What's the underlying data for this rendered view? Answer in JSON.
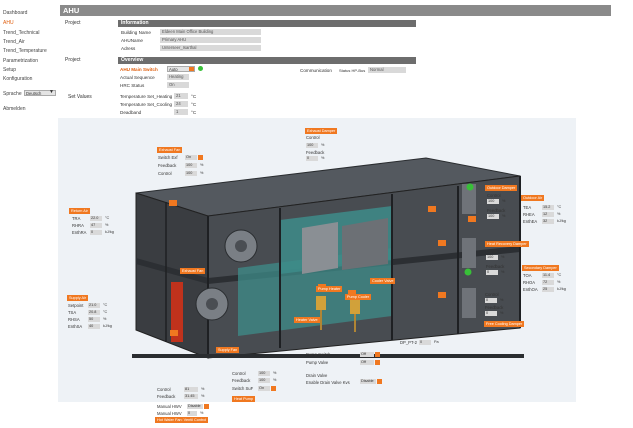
{
  "nav": {
    "items": [
      "Dashboard",
      "AHU",
      "Trend_Technical",
      "Trend_Air",
      "Trend_Temperature",
      "Parametrization",
      "Setup",
      "Konfiguration"
    ],
    "language_label": "Sprache",
    "language_value": "Deutsch",
    "logout": "Abmelden"
  },
  "page": {
    "title": "AHU"
  },
  "project": {
    "label": "Project",
    "information": {
      "header": "Information",
      "rows": [
        {
          "label": "Building Name",
          "value": "Eldeen Main Office Building"
        },
        {
          "label": "AHUName",
          "value": "Primary AHU"
        },
        {
          "label": "Adress",
          "value": "Unterseer_Isarthal"
        }
      ]
    }
  },
  "overview": {
    "header": "Overview",
    "label": "Project",
    "main_switch_label": "AHU Main Switch",
    "main_switch_value": "Auto",
    "actual_sequence_label": "Actual Sequence",
    "actual_sequence_value": "Heating",
    "hrc_status_label": "HRC Status",
    "hrc_status_value": "On",
    "communication_label": "Communication",
    "status_label": "Status HP-Bus",
    "status_value": "Normal"
  },
  "setvalues": {
    "label": "Set Values",
    "rows": [
      {
        "label": "Temperature Set_Heating",
        "value": "21",
        "unit": "°C"
      },
      {
        "label": "Temperature Set_Cooling",
        "value": "24",
        "unit": "°C"
      },
      {
        "label": "Deadband",
        "value": "1",
        "unit": "°C"
      }
    ]
  },
  "tags": {
    "exhaust_damper": "Exhaust Damper",
    "exhaust_fan": "Exhaust Fan",
    "return_air": "Return Air",
    "exhaust_air_fan": "Exhaust Fan",
    "outdoor_air": "Outdoor Air",
    "supply_air": "Supply Air",
    "outdoor_damper": "Outdoor Damper",
    "secondary_damper": "Secondary Damper",
    "heat_recovery": "Heat Recovery Damper",
    "free_cooling": "Free Cooling Damper",
    "supply_fan": "Supply Fan",
    "pump_heater": "Pump Heater",
    "pump_cooler": "Pump Cooler",
    "heater_valve": "Heater Valve",
    "cooler_valve": "Cooler Valve",
    "heat_pump": "Heat Pump",
    "hot_water_fan": "Hot Water Fan: Ventil Control"
  },
  "panels": {
    "exhaust_fan": {
      "switch_label": "Switch Exf",
      "switch_value": "On",
      "feedback_label": "Feedback",
      "feedback_value": "100",
      "control_label": "Control",
      "control_value": "100",
      "unit": "%"
    },
    "exhaust_damper": {
      "control_label": "Control",
      "control_value": "100",
      "feedback_label": "Feedback",
      "feedback_value": "0",
      "unit": "%"
    },
    "return_air": {
      "tra_label": "TRA",
      "tra_value": "22.0",
      "tra_unit": "°C",
      "rhra_label": "RHRA",
      "rhra_value": "47",
      "rhra_unit": "%",
      "enthra_label": "EnthRA",
      "enthra_value": "0",
      "enthra_unit": "kJ/kg"
    },
    "supply_air": {
      "rows": [
        {
          "label": "Setpoint",
          "value": "21.0",
          "unit": "°C"
        },
        {
          "label": "TSA",
          "value": "20.8",
          "unit": "°C"
        },
        {
          "label": "RHSA",
          "value": "50",
          "unit": "%"
        },
        {
          "label": "EnthSA",
          "value": "40",
          "unit": "kJ/kg"
        }
      ]
    },
    "outdoor_damper": {
      "control_label": "Control",
      "control_value": "100",
      "feedback_label": "Feedback",
      "feedback_value": "100",
      "unit": "%"
    },
    "exhaust_air": {
      "rows": [
        {
          "label": "TEA",
          "value": "15.2",
          "unit": "°C"
        },
        {
          "label": "RHEA",
          "value": "12",
          "unit": "%"
        },
        {
          "label": "EnthEA",
          "value": "32",
          "unit": "kJ/kg"
        }
      ]
    },
    "secondary_damper": {
      "control_label": "Control",
      "control_value": "100",
      "feedback_label": "Feedback",
      "feedback_value": "0",
      "unit": "%"
    },
    "outdoor_air": {
      "rows": [
        {
          "label": "TOA",
          "value": "11.4",
          "unit": "°C"
        },
        {
          "label": "RHOA",
          "value": "72",
          "unit": "%"
        },
        {
          "label": "EnthOA",
          "value": "25",
          "unit": "kJ/kg"
        }
      ]
    },
    "free_cooling": {
      "control_label": "Control",
      "control_value": "0",
      "feedback_label": "Feedback",
      "feedback_value": "0",
      "unit": "%"
    },
    "supply_fan": {
      "control_label": "Control",
      "control_value": "100",
      "feedback_label": "Feedback",
      "feedback_value": "100",
      "switch_label": "Switch SuF",
      "switch_value": "On",
      "unit": "%"
    },
    "heater": {
      "control_label": "Control",
      "control_value": "81",
      "feedback_label": "Feedback",
      "feedback_value": "31.45",
      "unit": "%",
      "manual_hwv_label": "Manual HWV",
      "manual_hwv_value": "Disable",
      "manual_hwv2_label": "Manual HWV",
      "manual_hwv2_value": "0"
    },
    "pump": {
      "switch_label": "Pump Switch",
      "switch_value": "Off",
      "valve_label": "Pump Valve",
      "valve_value": "Off",
      "drain_label": "Drain Valve",
      "enable_label": "Enable Drain Valve Kvs",
      "enable_value": "Disable"
    },
    "dp": {
      "label": "DP_PT-2",
      "value": "0",
      "unit": "Pa"
    }
  }
}
